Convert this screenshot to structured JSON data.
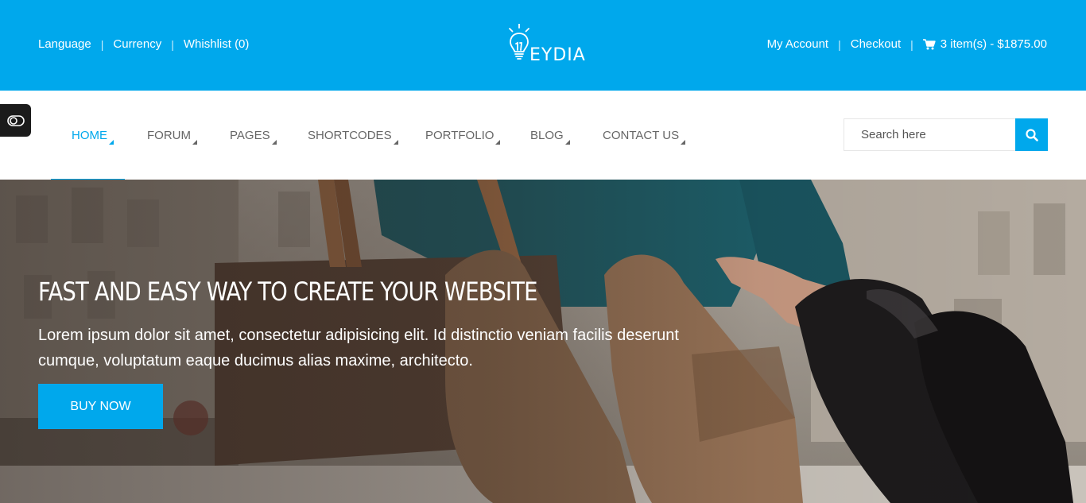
{
  "topbar": {
    "left_links": [
      "Language",
      "Currency",
      "Whishlist (0)"
    ],
    "right_links": [
      "My Account",
      "Checkout"
    ],
    "cart_label": "3 item(s) - $1875.00",
    "logo_text": "EYDIA"
  },
  "nav": {
    "items": [
      {
        "label": "HOME",
        "active": true
      },
      {
        "label": "FORUM"
      },
      {
        "label": "PAGES"
      },
      {
        "label": "SHORTCODES"
      },
      {
        "label": "PORTFOLIO"
      },
      {
        "label": "BLOG"
      },
      {
        "label": "CONTACT US"
      }
    ],
    "search_placeholder": "Search here"
  },
  "hero": {
    "title": "FAST AND EASY WAY TO CREATE YOUR WEBSITE",
    "text": "Lorem ipsum dolor sit amet, consectetur adipisicing elit. Id distinctio veniam facilis deserunt cumque, voluptatum eaque ducimus alias maxime, architecto.",
    "button_label": "BUY NOW"
  },
  "colors": {
    "accent": "#00a8ec",
    "nav_text": "#666666",
    "toggle_bg": "#1b1b1b"
  },
  "icons": [
    "lightbulb-logo-icon",
    "cart-icon",
    "toggle-icon",
    "search-icon"
  ]
}
